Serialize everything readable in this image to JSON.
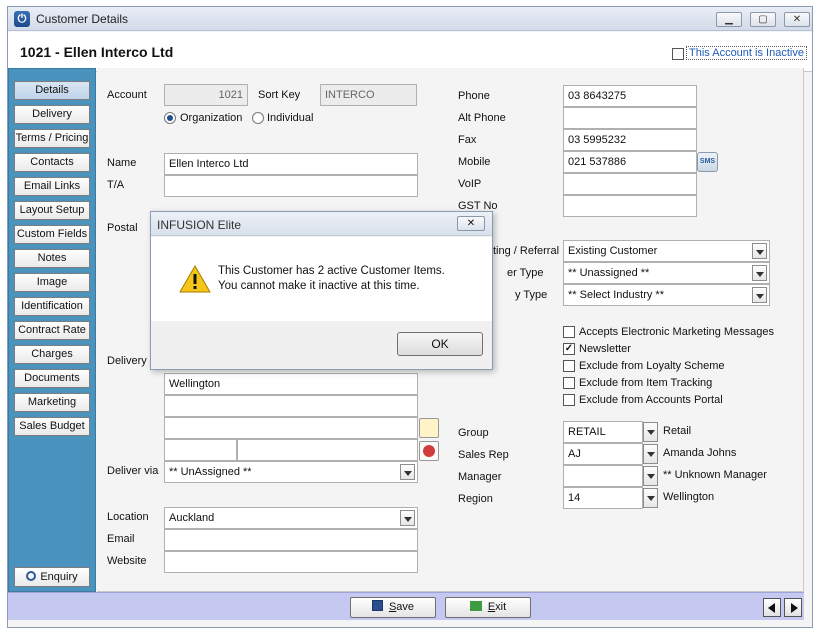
{
  "window": {
    "title": "Customer Details"
  },
  "header": {
    "title": "1021 - Ellen Interco Ltd",
    "inactive_label": "This Account is Inactive"
  },
  "sidebar": {
    "items": [
      "Details",
      "Delivery",
      "Terms / Pricing",
      "Contacts",
      "Email Links",
      "Layout Setup",
      "Custom Fields",
      "Notes",
      "Image",
      "Identification",
      "Contract Rate",
      "Charges",
      "Documents",
      "Marketing",
      "Sales Budget"
    ],
    "enquiry": "Enquiry"
  },
  "form": {
    "account_label": "Account",
    "account": "1021",
    "sortkey_label": "Sort Key",
    "sortkey": "INTERCO",
    "org_label": "Organization",
    "ind_label": "Individual",
    "name_label": "Name",
    "name": "Ellen Interco Ltd",
    "ta_label": "T/A",
    "postal_label": "Postal",
    "delivery_label": "Delivery",
    "delivery_city": "Wellington",
    "deliver_via_label": "Deliver via",
    "deliver_via": "** UnAssigned **",
    "location_label": "Location",
    "location": "Auckland",
    "email_label": "Email",
    "website_label": "Website",
    "phone_label": "Phone",
    "phone": "03 8643275",
    "altphone_label": "Alt Phone",
    "fax_label": "Fax",
    "fax": "03 5995232",
    "mobile_label": "Mobile",
    "mobile": "021 537886",
    "sms": "SMS",
    "voip_label": "VoIP",
    "gst_label": "GST No",
    "referral_label": "ting / Referral",
    "referral": "Existing Customer",
    "custtype_label": "er Type",
    "custtype": "** Unassigned **",
    "industry_label": "y Type",
    "industry": "** Select Industry **",
    "group_label": "Group",
    "group": "RETAIL",
    "group_desc": "Retail",
    "salesrep_label": "Sales Rep",
    "salesrep": "AJ",
    "salesrep_desc": "Amanda Johns",
    "manager_label": "Manager",
    "manager_desc": "** Unknown Manager",
    "region_label": "Region",
    "region": "14",
    "region_desc": "Wellington"
  },
  "checks": {
    "items": [
      {
        "label": "Accepts Electronic Marketing Messages",
        "checked": false
      },
      {
        "label": "Newsletter",
        "checked": true
      },
      {
        "label": "Exclude from Loyalty Scheme",
        "checked": false
      },
      {
        "label": "Exclude from Item Tracking",
        "checked": false
      },
      {
        "label": "Exclude from Accounts Portal",
        "checked": false
      }
    ]
  },
  "buttons": {
    "save_rest": "ave",
    "save_u": "S",
    "exit_rest": "xit",
    "exit_u": "E"
  },
  "dialog": {
    "title": "INFUSION Elite",
    "line1": "This Customer has 2 active  Customer Items.",
    "line2": "You cannot make it inactive at this time.",
    "ok": "OK"
  },
  "colors": {
    "sidebar": "#4a93be",
    "bottombar": "#c5c8f1",
    "accent": "#1c5bb8"
  }
}
